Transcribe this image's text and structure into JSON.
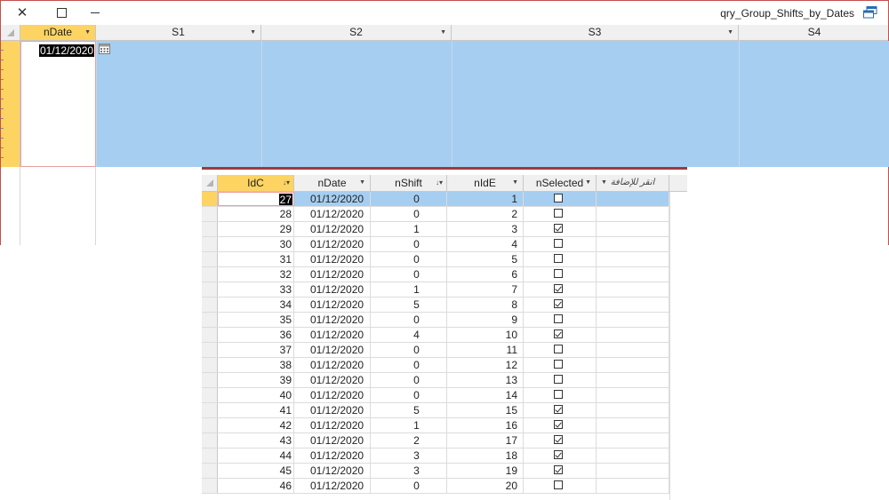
{
  "query_window": {
    "title": "qry_Group_Shifts_by_Dates",
    "columns": [
      {
        "label": "nDate"
      },
      {
        "label": "S1"
      },
      {
        "label": "S2"
      },
      {
        "label": "S3"
      },
      {
        "label": "S4"
      }
    ],
    "row": {
      "ndate": "01/12/2020"
    }
  },
  "table_window": {
    "columns": {
      "idc": "IdC",
      "ndate": "nDate",
      "nshift": "nShift",
      "nide": "nIdE",
      "nselected": "nSelected",
      "add_field": "انقر للإضافة"
    },
    "rows": [
      {
        "idc": "27",
        "ndate": "01/12/2020",
        "nshift": "0",
        "nide": "1",
        "selected": false
      },
      {
        "idc": "28",
        "ndate": "01/12/2020",
        "nshift": "0",
        "nide": "2",
        "selected": false
      },
      {
        "idc": "29",
        "ndate": "01/12/2020",
        "nshift": "1",
        "nide": "3",
        "selected": true
      },
      {
        "idc": "30",
        "ndate": "01/12/2020",
        "nshift": "0",
        "nide": "4",
        "selected": false
      },
      {
        "idc": "31",
        "ndate": "01/12/2020",
        "nshift": "0",
        "nide": "5",
        "selected": false
      },
      {
        "idc": "32",
        "ndate": "01/12/2020",
        "nshift": "0",
        "nide": "6",
        "selected": false
      },
      {
        "idc": "33",
        "ndate": "01/12/2020",
        "nshift": "1",
        "nide": "7",
        "selected": true
      },
      {
        "idc": "34",
        "ndate": "01/12/2020",
        "nshift": "5",
        "nide": "8",
        "selected": true
      },
      {
        "idc": "35",
        "ndate": "01/12/2020",
        "nshift": "0",
        "nide": "9",
        "selected": false
      },
      {
        "idc": "36",
        "ndate": "01/12/2020",
        "nshift": "4",
        "nide": "10",
        "selected": true
      },
      {
        "idc": "37",
        "ndate": "01/12/2020",
        "nshift": "0",
        "nide": "11",
        "selected": false
      },
      {
        "idc": "38",
        "ndate": "01/12/2020",
        "nshift": "0",
        "nide": "12",
        "selected": false
      },
      {
        "idc": "39",
        "ndate": "01/12/2020",
        "nshift": "0",
        "nide": "13",
        "selected": false
      },
      {
        "idc": "40",
        "ndate": "01/12/2020",
        "nshift": "0",
        "nide": "14",
        "selected": false
      },
      {
        "idc": "41",
        "ndate": "01/12/2020",
        "nshift": "5",
        "nide": "15",
        "selected": true
      },
      {
        "idc": "42",
        "ndate": "01/12/2020",
        "nshift": "1",
        "nide": "16",
        "selected": true
      },
      {
        "idc": "43",
        "ndate": "01/12/2020",
        "nshift": "2",
        "nide": "17",
        "selected": true
      },
      {
        "idc": "44",
        "ndate": "01/12/2020",
        "nshift": "3",
        "nide": "18",
        "selected": true
      },
      {
        "idc": "45",
        "ndate": "01/12/2020",
        "nshift": "3",
        "nide": "19",
        "selected": true
      },
      {
        "idc": "46",
        "ndate": "01/12/2020",
        "nshift": "0",
        "nide": "20",
        "selected": false
      }
    ]
  },
  "colors": {
    "selection_blue": "#a6cef0",
    "active_yellow": "#fdd462",
    "window_border": "#c0504d"
  },
  "icons": {
    "close": "close-icon",
    "restore": "restore-icon",
    "minimize": "minimize-icon",
    "window": "datasheet-window-icon",
    "calendar": "calendar-icon",
    "dropdown": "chevron-down-icon",
    "sort_asc": "sort-ascending-icon"
  }
}
